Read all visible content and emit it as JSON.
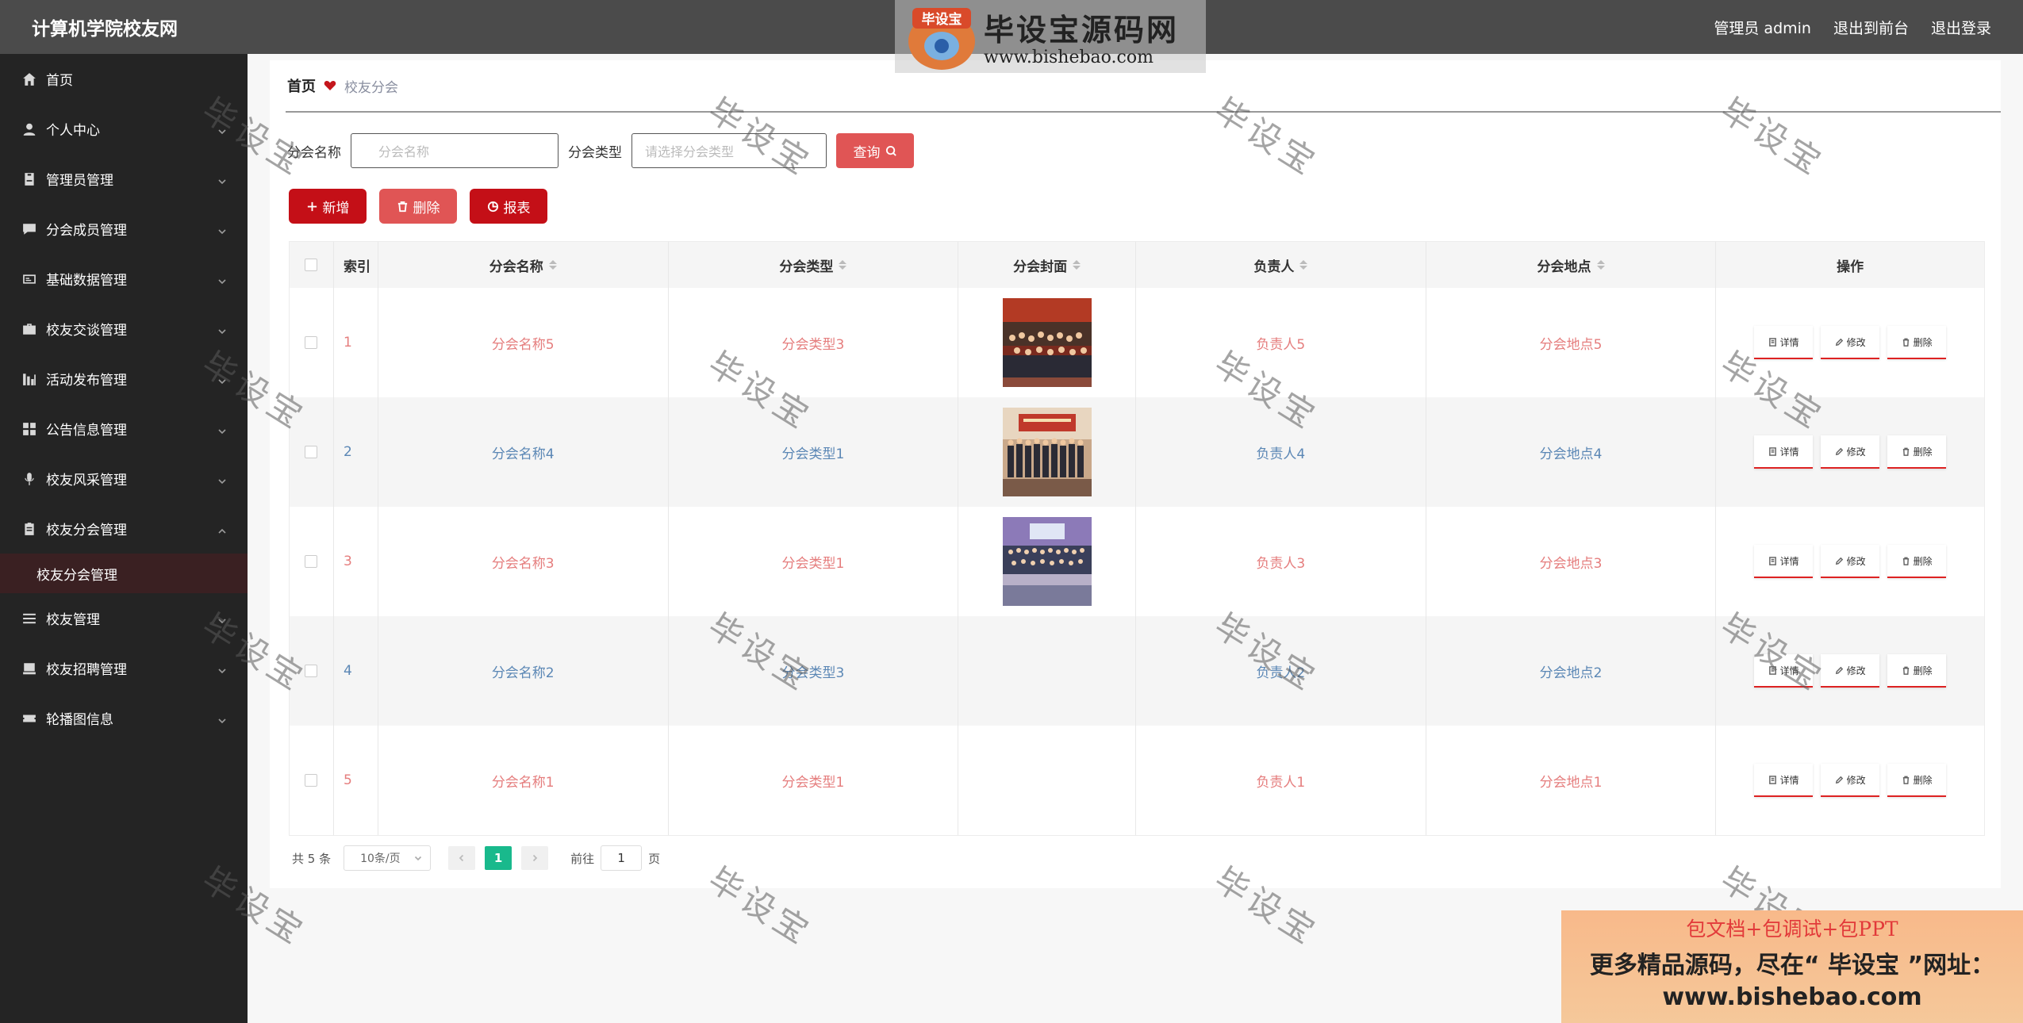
{
  "header": {
    "brand": "计算机学院校友网",
    "user": "管理员 admin",
    "to_front": "退出到前台",
    "logout": "退出登录"
  },
  "sidebar": {
    "items": [
      {
        "label": "首页",
        "icon": "home-icon",
        "has_chevron": false
      },
      {
        "label": "个人中心",
        "icon": "user-icon",
        "has_chevron": true
      },
      {
        "label": "管理员管理",
        "icon": "badge-icon",
        "has_chevron": true
      },
      {
        "label": "分会成员管理",
        "icon": "chat-icon",
        "has_chevron": true
      },
      {
        "label": "基础数据管理",
        "icon": "card-icon",
        "has_chevron": true
      },
      {
        "label": "校友交谈管理",
        "icon": "briefcase-icon",
        "has_chevron": true
      },
      {
        "label": "活动发布管理",
        "icon": "chart-icon",
        "has_chevron": true
      },
      {
        "label": "公告信息管理",
        "icon": "grid-icon",
        "has_chevron": true
      },
      {
        "label": "校友风采管理",
        "icon": "mic-icon",
        "has_chevron": true
      },
      {
        "label": "校友分会管理",
        "icon": "clipboard-icon",
        "has_chevron": true,
        "expanded": true
      },
      {
        "label": "校友管理",
        "icon": "list-icon",
        "has_chevron": true
      },
      {
        "label": "校友招聘管理",
        "icon": "monitor-icon",
        "has_chevron": true
      },
      {
        "label": "轮播图信息",
        "icon": "ticket-icon",
        "has_chevron": true
      }
    ],
    "submenu_active": "校友分会管理"
  },
  "breadcrumb": {
    "home": "首页",
    "current": "校友分会"
  },
  "search": {
    "name_label": "分会名称",
    "name_placeholder": "分会名称",
    "type_label": "分会类型",
    "type_placeholder": "请选择分会类型",
    "query_label": "查询"
  },
  "actions": {
    "add": "新增",
    "delete": "删除",
    "report": "报表"
  },
  "table": {
    "columns": [
      "索引",
      "分会名称",
      "分会类型",
      "分会封面",
      "负责人",
      "分会地点",
      "操作"
    ],
    "rows": [
      {
        "index": "1",
        "name": "分会名称5",
        "type": "分会类型3",
        "has_cover": true,
        "owner": "负责人5",
        "location": "分会地点5"
      },
      {
        "index": "2",
        "name": "分会名称4",
        "type": "分会类型1",
        "has_cover": true,
        "owner": "负责人4",
        "location": "分会地点4"
      },
      {
        "index": "3",
        "name": "分会名称3",
        "type": "分会类型1",
        "has_cover": true,
        "owner": "负责人3",
        "location": "分会地点3"
      },
      {
        "index": "4",
        "name": "分会名称2",
        "type": "分会类型3",
        "has_cover": false,
        "owner": "负责人2",
        "location": "分会地点2"
      },
      {
        "index": "5",
        "name": "分会名称1",
        "type": "分会类型1",
        "has_cover": false,
        "owner": "负责人1",
        "location": "分会地点1"
      }
    ],
    "ops": {
      "detail": "详情",
      "edit": "修改",
      "delete": "删除"
    }
  },
  "pagination": {
    "total": "共 5 条",
    "page_size": "10条/页",
    "current": "1",
    "goto_prefix": "前往",
    "goto_value": "1",
    "goto_suffix": "页"
  },
  "watermarks": {
    "logo_main": "毕设宝源码网",
    "logo_url": "www.bishebao.com",
    "logo_badge": "毕设宝",
    "diagonal": "毕设宝"
  },
  "promo": {
    "line1": "包文档+包调试+包PPT",
    "line2": "更多精品源码，尽在“ 毕设宝 ”网址：",
    "line3": "www.bishebao.com"
  },
  "colors": {
    "header_bg": "#4b4b4b",
    "sidebar_bg": "#242424",
    "accent_red": "#c40f17",
    "light_red": "#e05555",
    "page_active": "#19b98c",
    "row_red_text": "#e57d7d",
    "row_blue_text": "#5b87b5"
  }
}
